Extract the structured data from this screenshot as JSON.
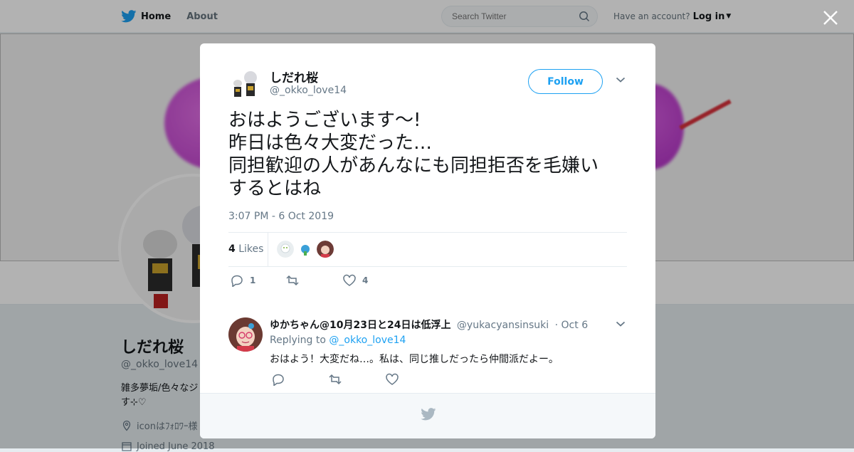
{
  "nav": {
    "home_label": "Home",
    "about_label": "About",
    "search_placeholder": "Search Twitter",
    "account_prompt": "Have an account?",
    "login_label": "Log in"
  },
  "profile": {
    "name": "しだれ桜",
    "handle": "@_okko_love14",
    "bio": "雑多夢垢/色々なジ",
    "bio_line2": "す⊹♡",
    "location": "iconはﾌｫﾛﾜｰ様",
    "joined": "Joined June 2018"
  },
  "tweet": {
    "author_name": "しだれ桜",
    "author_handle": "@_okko_love14",
    "follow_label": "Follow",
    "text": "おはようございます〜!\n昨日は色々大変だった…\n同担歓迎の人があんなにも同担拒否を毛嫌い\nするとはね",
    "timestamp": "3:07 PM - 6 Oct 2019",
    "likes_count": "4",
    "likes_label": "Likes",
    "reply_count": "1",
    "retweet_count": "",
    "like_count": "4"
  },
  "reply": {
    "author_name": "ゆかちゃん@10月23日と24日は低浮上",
    "author_handle": "@yukacyansinsuki",
    "date": "Oct 6",
    "replying_prefix": "Replying to",
    "replying_to": "@_okko_love14",
    "text": "おはよう！大変だね…。私は、同じ推しだったら仲間派だよー。"
  },
  "colors": {
    "twitter_blue": "#1da1f2",
    "text_primary": "#14171a",
    "text_secondary": "#657786"
  }
}
